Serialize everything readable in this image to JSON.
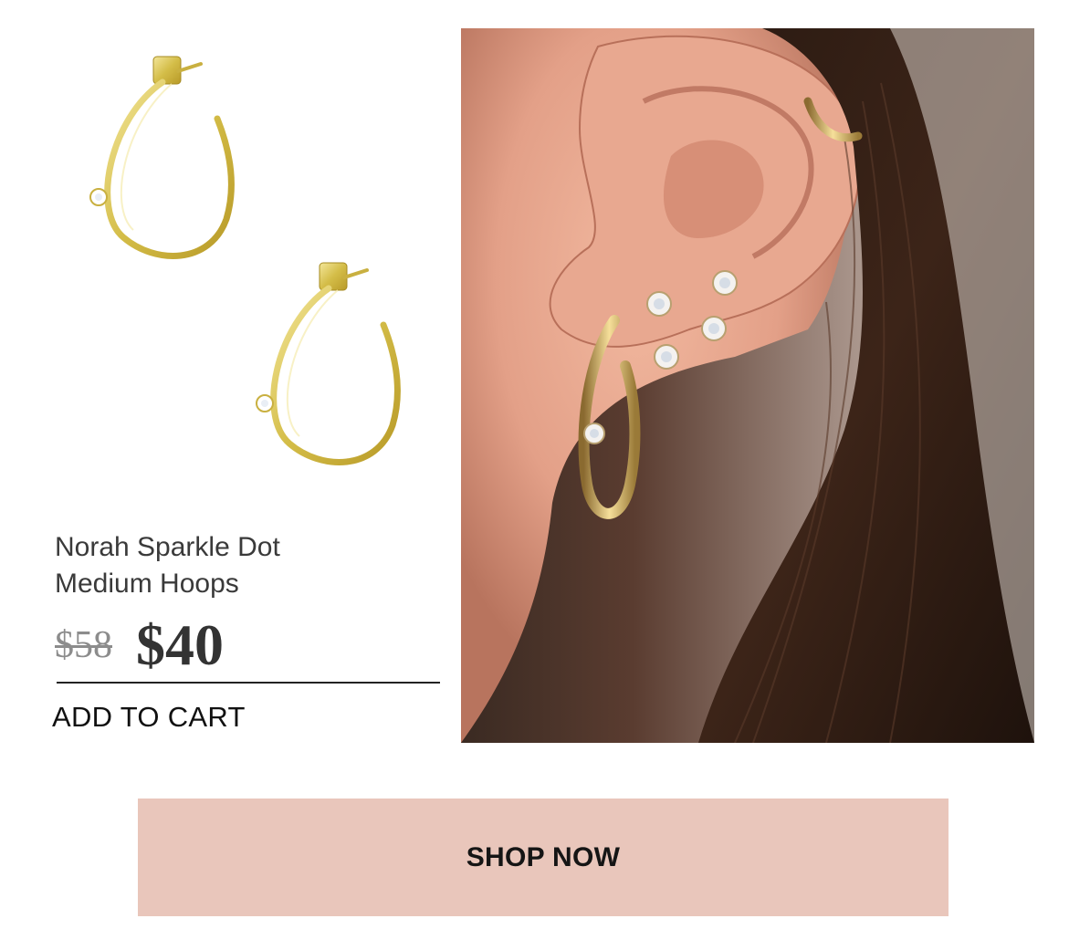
{
  "product": {
    "name_line1": "Norah Sparkle Dot",
    "name_line2": "Medium Hoops",
    "original_price": "$58",
    "sale_price": "$40",
    "add_to_cart_label": "ADD TO CART",
    "image_icon": "gold-hoop-earrings-image"
  },
  "lifestyle": {
    "image_icon": "ear-wearing-earrings-photo"
  },
  "cta": {
    "shop_now_label": "SHOP NOW"
  },
  "colors": {
    "gold": "#d8c25a",
    "cta_background": "#e9c6bb",
    "text_dark": "#2b2b2b",
    "strike_price": "#8c8c8c"
  }
}
